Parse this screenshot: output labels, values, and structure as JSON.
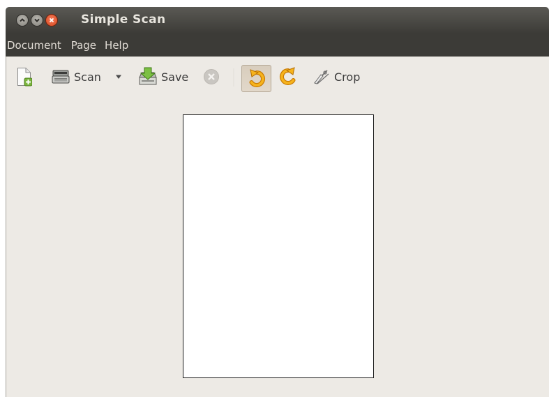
{
  "window": {
    "title": "Simple Scan",
    "controls": [
      "minimize-icon",
      "maximize-icon",
      "close-icon"
    ]
  },
  "menubar": {
    "items": [
      {
        "label": "Document"
      },
      {
        "label": "Page"
      },
      {
        "label": "Help"
      }
    ]
  },
  "toolbar": {
    "new_icon": "new-document-icon",
    "scan_label": "Scan",
    "scan_dropdown_icon": "dropdown-arrow-icon",
    "save_label": "Save",
    "stop_icon": "stop-scan-icon",
    "rotate_left_icon": "rotate-left-icon",
    "rotate_right_icon": "rotate-right-icon",
    "crop_label": "Crop"
  },
  "colors": {
    "titlebar": "#3c3b37",
    "background": "#edeae5",
    "close_button": "#e0552a",
    "rotate_icon": "#f0a30a"
  }
}
